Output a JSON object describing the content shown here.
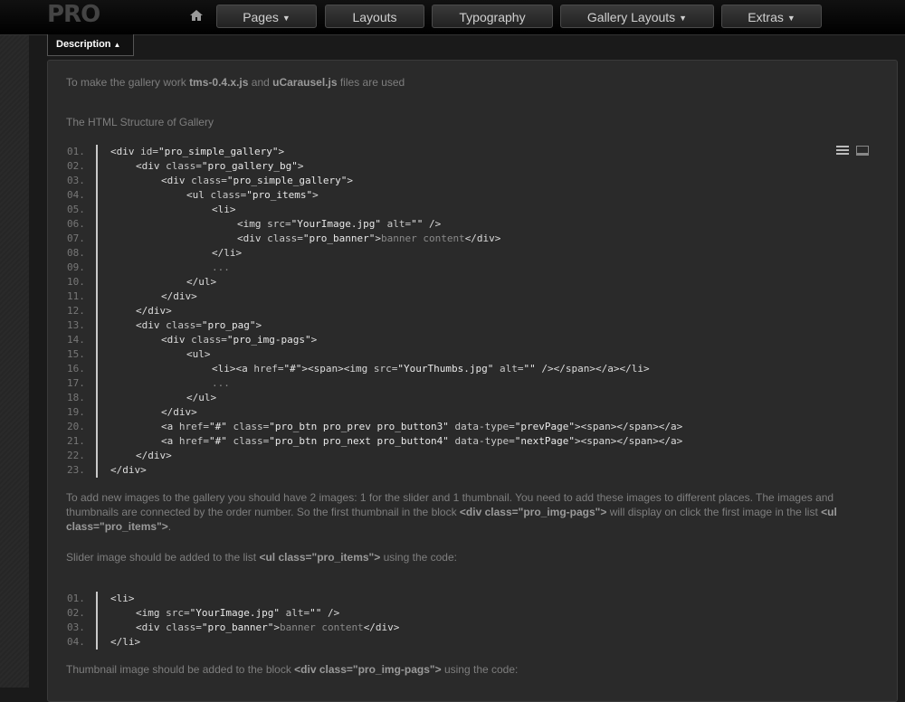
{
  "nav": {
    "logo": "PRO",
    "items": [
      {
        "label": "Pages",
        "dropdown": true
      },
      {
        "label": "Layouts",
        "dropdown": false
      },
      {
        "label": "Typography",
        "dropdown": false
      },
      {
        "label": "Gallery Layouts",
        "dropdown": true
      },
      {
        "label": "Extras",
        "dropdown": true
      }
    ],
    "home_icon": "home-icon"
  },
  "tab": {
    "label": "Description",
    "icon": "caret-up-icon"
  },
  "content": {
    "p1": {
      "pre": "To make the gallery work ",
      "b1": "tms-0.4.x.js",
      "mid": " and ",
      "b2": "uCarausel.js",
      "post": " files are used"
    },
    "p2": "The HTML Structure of Gallery",
    "p3": {
      "a": "To add new images to the gallery you should have 2 images: 1 for the slider and 1 thumbnail. You need to add these images to different places. The images and thumbnails are connected by the order number. So the first thumbnail in the block ",
      "b1": "<div class=\"pro_img-pags\">",
      "c": " will display on click the first image in the list ",
      "b2": "<ul class=\"pro_items\">",
      "d": "."
    },
    "p4": {
      "pre": "Slider image should be added to the list ",
      "b": "<ul class=\"pro_items\">",
      "post": " using the code:"
    },
    "p5": {
      "pre": "Thumbnail image should be added to the block ",
      "b": "<div class=\"pro_img-pags\">",
      "post": " using the code:"
    }
  },
  "code_icons": [
    "view-source-icon",
    "copy-icon"
  ],
  "code1": [
    {
      "n": "01.",
      "i": 0,
      "h": "<div id=\"pro_simple_gallery\">"
    },
    {
      "n": "02.",
      "i": 1,
      "h": "<div class=\"pro_gallery_bg\">"
    },
    {
      "n": "03.",
      "i": 2,
      "h": "<div class=\"pro_simple_gallery\">"
    },
    {
      "n": "04.",
      "i": 3,
      "h": "<ul class=\"pro_items\">"
    },
    {
      "n": "05.",
      "i": 4,
      "h": "<li>"
    },
    {
      "n": "06.",
      "i": 5,
      "h": "<img src=\"YourImage.jpg\" alt=\"\" />"
    },
    {
      "n": "07.",
      "i": 5,
      "h": "<div class=\"pro_banner\">banner content</div>"
    },
    {
      "n": "08.",
      "i": 4,
      "h": "</li>"
    },
    {
      "n": "09.",
      "i": 4,
      "h": "..."
    },
    {
      "n": "10.",
      "i": 3,
      "h": "</ul>"
    },
    {
      "n": "11.",
      "i": 2,
      "h": "</div>"
    },
    {
      "n": "12.",
      "i": 1,
      "h": "</div>"
    },
    {
      "n": "13.",
      "i": 1,
      "h": "<div class=\"pro_pag\">"
    },
    {
      "n": "14.",
      "i": 2,
      "h": "<div class=\"pro_img-pags\">"
    },
    {
      "n": "15.",
      "i": 3,
      "h": "<ul>"
    },
    {
      "n": "16.",
      "i": 4,
      "h": "<li><a href=\"#\"><span><img src=\"YourThumbs.jpg\" alt=\"\" /></span></a></li>"
    },
    {
      "n": "17.",
      "i": 4,
      "h": "..."
    },
    {
      "n": "18.",
      "i": 3,
      "h": "</ul>"
    },
    {
      "n": "19.",
      "i": 2,
      "h": "</div>"
    },
    {
      "n": "20.",
      "i": 2,
      "h": "<a href=\"#\" class=\"pro_btn pro_prev pro_button3\" data-type=\"prevPage\"><span></span></a>"
    },
    {
      "n": "21.",
      "i": 2,
      "h": "<a href=\"#\" class=\"pro_btn pro_next pro_button4\" data-type=\"nextPage\"><span></span></a>"
    },
    {
      "n": "22.",
      "i": 1,
      "h": "</div>"
    },
    {
      "n": "23.",
      "i": 0,
      "h": "</div>"
    }
  ],
  "code2": [
    {
      "n": "01.",
      "i": 0,
      "h": "<li>"
    },
    {
      "n": "02.",
      "i": 1,
      "h": "<img src=\"YourImage.jpg\" alt=\"\" />"
    },
    {
      "n": "03.",
      "i": 1,
      "h": "<div class=\"pro_banner\">banner content</div>"
    },
    {
      "n": "04.",
      "i": 0,
      "h": "</li>"
    }
  ]
}
